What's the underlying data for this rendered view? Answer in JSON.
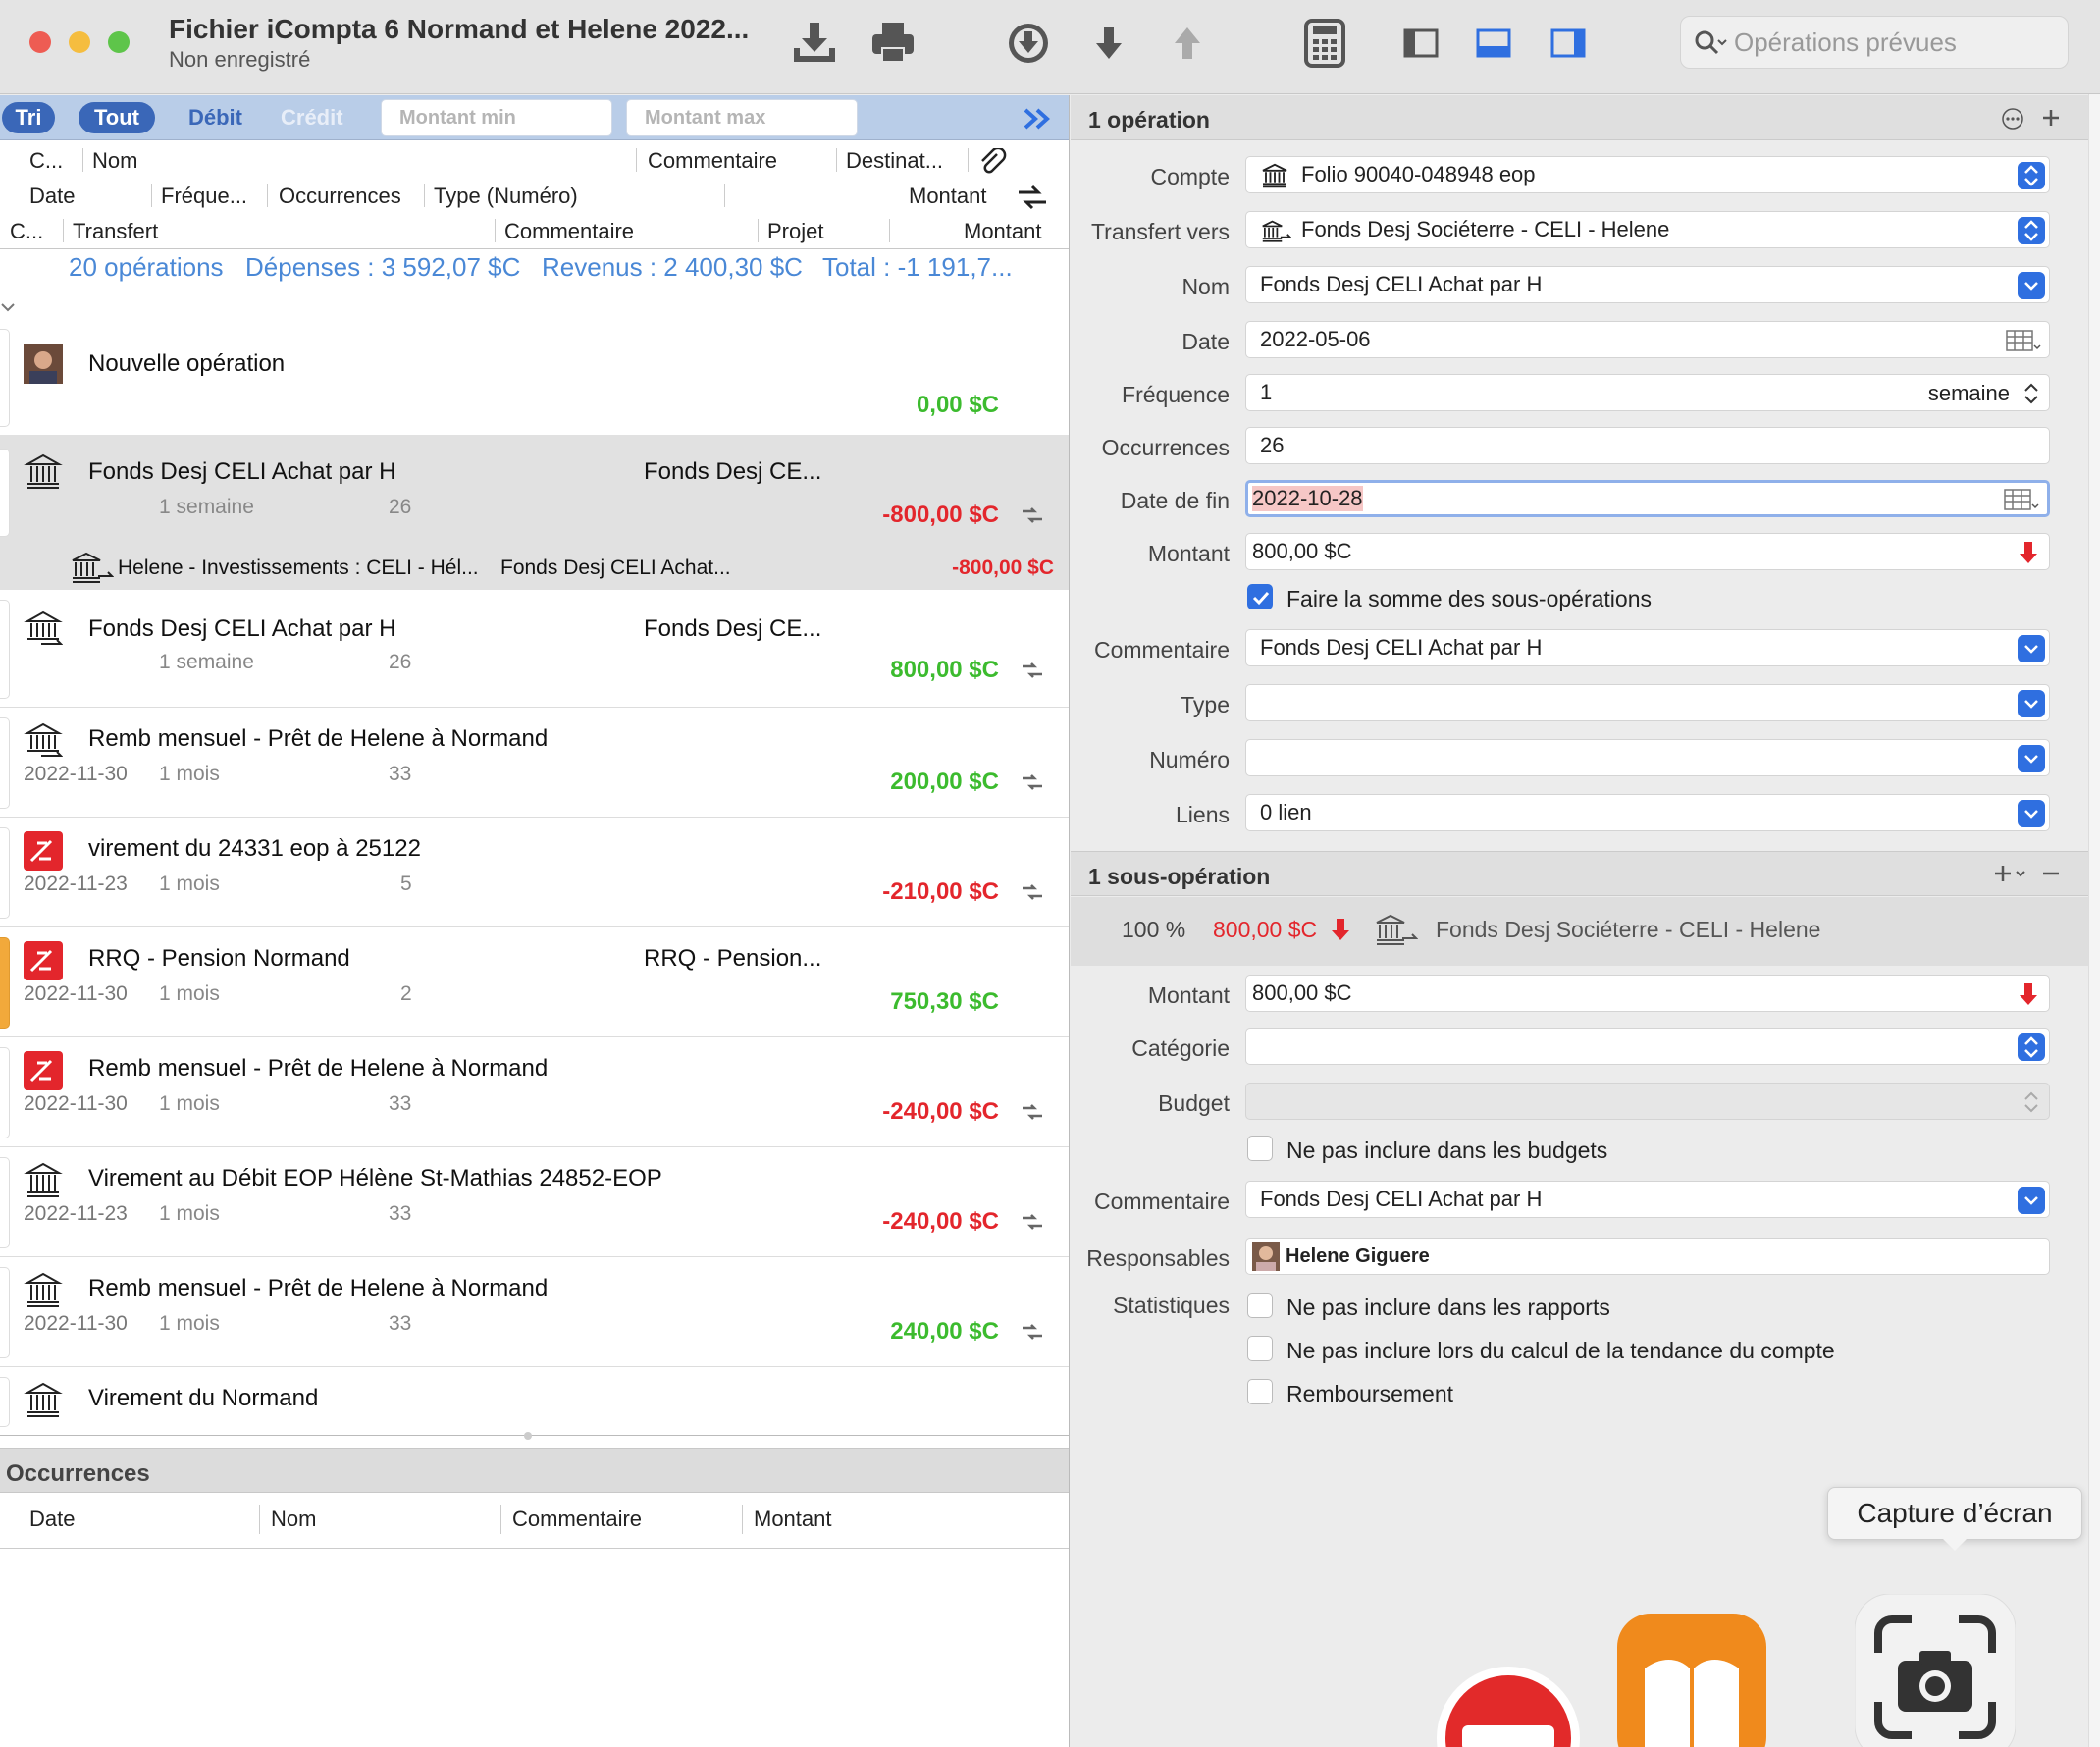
{
  "window": {
    "title": "Fichier iCompta 6 Normand et Helene 2022...",
    "subtitle": "Non enregistré",
    "search_placeholder": "Opérations prévues"
  },
  "filter": {
    "tri": "Tri",
    "tout": "Tout",
    "debit": "Débit",
    "credit": "Crédit",
    "montant_min": "Montant min",
    "montant_max": "Montant max"
  },
  "columns": {
    "row1": [
      "C...",
      "Nom",
      "Commentaire",
      "Destinat..."
    ],
    "row2": [
      "Date",
      "Fréque...",
      "Occurrences",
      "Type (Numéro)",
      "Montant"
    ],
    "row3": [
      "C...",
      "Transfert",
      "Commentaire",
      "Projet",
      "Montant"
    ]
  },
  "summary": {
    "count": "20 opérations",
    "depenses": "Dépenses : 3 592,07 $C",
    "revenus": "Revenus : 2 400,30 $C",
    "total": "Total : -1 191,7..."
  },
  "rows": [
    {
      "name": "Nouvelle opération",
      "amount": "0,00 $C",
      "sign": "pos"
    },
    {
      "name": "Fonds Desj CELI   Achat par H",
      "dest": "Fonds Desj CE...",
      "freq": "1 semaine",
      "occ": "26",
      "amount": "-800,00 $C",
      "sign": "neg",
      "split": {
        "transfer": "Helene - Investissements : CELI - Hél...",
        "comment": "Fonds Desj CELI   Achat...",
        "amount": "-800,00 $C"
      }
    },
    {
      "name": "Fonds Desj CELI   Achat par H",
      "dest": "Fonds Desj CE...",
      "freq": "1 semaine",
      "occ": "26",
      "amount": "800,00 $C",
      "sign": "pos"
    },
    {
      "name": "Remb mensuel - Prêt de Helene à Normand",
      "date": "2022-11-30",
      "freq": "1 mois",
      "occ": "33",
      "amount": "200,00 $C",
      "sign": "pos"
    },
    {
      "name": "virement du 24331 eop à 25122",
      "date": "2022-11-23",
      "freq": "1 mois",
      "occ": "5",
      "amount": "-210,00 $C",
      "sign": "neg"
    },
    {
      "name": "RRQ - Pension Normand",
      "dest": "RRQ - Pension...",
      "date": "2022-11-30",
      "freq": "1 mois",
      "occ": "2",
      "amount": "750,30 $C",
      "sign": "pos"
    },
    {
      "name": "Remb mensuel - Prêt de Helene à Normand",
      "date": "2022-11-30",
      "freq": "1 mois",
      "occ": "33",
      "amount": "-240,00 $C",
      "sign": "neg"
    },
    {
      "name": "Virement au Débit EOP Hélène St-Mathias 24852-EOP",
      "date": "2022-11-23",
      "freq": "1 mois",
      "occ": "33",
      "amount": "-240,00 $C",
      "sign": "neg"
    },
    {
      "name": "Remb mensuel - Prêt de Helene à Normand",
      "date": "2022-11-30",
      "freq": "1 mois",
      "occ": "33",
      "amount": "240,00 $C",
      "sign": "pos"
    },
    {
      "name": "Virement du Normand"
    }
  ],
  "occurrences": {
    "title": "Occurrences",
    "cols": [
      "Date",
      "Nom",
      "Commentaire",
      "Montant"
    ]
  },
  "detail": {
    "header": "1 opération",
    "fields": {
      "compte": {
        "label": "Compte",
        "value": "Folio 90040-048948 eop"
      },
      "transfert": {
        "label": "Transfert vers",
        "value": "Fonds Desj Sociéterre  - CELI - Helene"
      },
      "nom": {
        "label": "Nom",
        "value": "Fonds Desj CELI   Achat par H"
      },
      "date": {
        "label": "Date",
        "value": "2022-05-06"
      },
      "frequence": {
        "label": "Fréquence",
        "value": "1",
        "unit": "semaine"
      },
      "occurrences": {
        "label": "Occurrences",
        "value": "26"
      },
      "date_fin": {
        "label": "Date de fin",
        "value": "2022-10-28"
      },
      "montant": {
        "label": "Montant",
        "value": "800,00 $C"
      },
      "somme": "Faire la somme des sous-opérations",
      "commentaire": {
        "label": "Commentaire",
        "value": "Fonds Desj CELI   Achat par H"
      },
      "type": {
        "label": "Type",
        "value": ""
      },
      "numero": {
        "label": "Numéro",
        "value": ""
      },
      "liens": {
        "label": "Liens",
        "value": "0 lien"
      }
    }
  },
  "sub": {
    "header": "1 sous-opération",
    "percent": "100 %",
    "amount": "800,00 $C",
    "account": "Fonds Desj Sociéterre  - CELI - Helene",
    "montant": {
      "label": "Montant",
      "value": "800,00 $C"
    },
    "categorie": {
      "label": "Catégorie",
      "value": ""
    },
    "budget": {
      "label": "Budget",
      "value": ""
    },
    "no_budget": "Ne pas inclure dans les budgets",
    "commentaire": {
      "label": "Commentaire",
      "value": "Fonds Desj CELI   Achat par H"
    },
    "responsables": {
      "label": "Responsables",
      "value": "Helene Giguere"
    },
    "statistiques": "Statistiques",
    "no_rapports": "Ne pas inclure dans les rapports",
    "no_tendance": "Ne pas inclure lors du calcul de la tendance du compte",
    "remboursement": "Remboursement"
  },
  "tooltip": "Capture d’écran",
  "colors": {
    "accent": "#2f6fe0",
    "positive": "#3cbb2e",
    "negative": "#e3262c",
    "filter_bar": "#b9cde8"
  }
}
